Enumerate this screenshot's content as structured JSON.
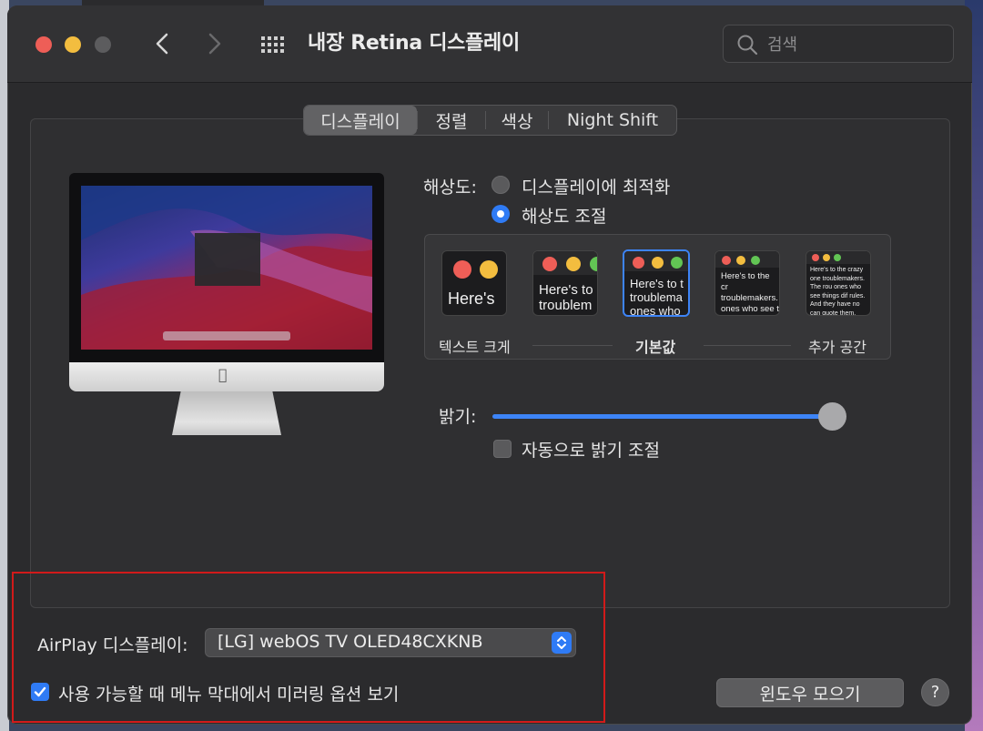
{
  "window": {
    "title": "내장 Retina 디스플레이",
    "search_placeholder": "검색"
  },
  "tabs": [
    {
      "label": "디스플레이",
      "active": true
    },
    {
      "label": "정렬",
      "active": false
    },
    {
      "label": "색상",
      "active": false
    },
    {
      "label": "Night Shift",
      "active": false
    }
  ],
  "resolution": {
    "label": "해상도:",
    "options": [
      {
        "label": "디스플레이에 최적화",
        "selected": false
      },
      {
        "label": "해상도 조절",
        "selected": true
      }
    ]
  },
  "scaling": {
    "thumbnails": [
      {
        "text": "Here's",
        "selected": false
      },
      {
        "text": "Here's to troublem",
        "selected": false
      },
      {
        "text": "Here's to t troublema ones who",
        "selected": true
      },
      {
        "text": "Here's to the cr troublemakers. ones who see t rules. And they",
        "selected": false
      },
      {
        "text": "Here's to the crazy one troublemakers. The rou ones who see things dif rules. And they have no can quote them, disagre them. About the only th Because they change th",
        "selected": false
      }
    ],
    "left_label": "텍스트 크게",
    "center_label": "기본값",
    "right_label": "추가 공간"
  },
  "brightness": {
    "label": "밝기:",
    "value": 1.0,
    "auto_label": "자동으로 밝기 조절",
    "auto_checked": false
  },
  "airplay": {
    "label": "AirPlay 디스플레이:",
    "selected": "[LG] webOS TV OLED48CXKNB",
    "mirroring_label": "사용 가능할 때 메뉴 막대에서 미러링 옵션 보기",
    "mirroring_checked": true
  },
  "buttons": {
    "gather_windows": "윈도우 모으기",
    "help": "?"
  },
  "colors": {
    "accent": "#2f7bf5",
    "highlight_box": "#d21a1a"
  }
}
